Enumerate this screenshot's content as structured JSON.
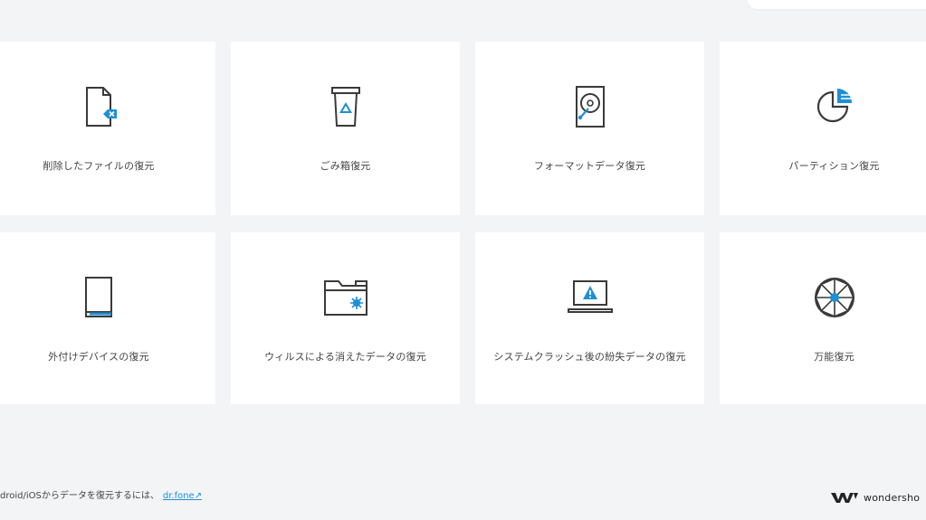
{
  "cards": [
    {
      "label": "削除したファイルの復元",
      "icon": "deleted-file-icon"
    },
    {
      "label": "ごみ箱復元",
      "icon": "recycle-bin-icon"
    },
    {
      "label": "フォーマットデータ復元",
      "icon": "hard-drive-icon"
    },
    {
      "label": "パーティション復元",
      "icon": "partition-icon"
    },
    {
      "label": "外付けデバイスの復元",
      "icon": "external-device-icon"
    },
    {
      "label": "ウィルスによる消えたデータの復元",
      "icon": "virus-folder-icon"
    },
    {
      "label": "システムクラッシュ後の紛失データの復元",
      "icon": "system-crash-icon"
    },
    {
      "label": "万能復元",
      "icon": "all-round-icon"
    }
  ],
  "footer": {
    "text": "droid/iOSからデータを復元するには、",
    "link": "dr.fone↗"
  },
  "brand": {
    "name": "wondersho"
  },
  "colors": {
    "accent": "#1e8fd6",
    "icon_stroke": "#3a3a3a",
    "background": "#f3f4f6",
    "card": "#ffffff"
  }
}
